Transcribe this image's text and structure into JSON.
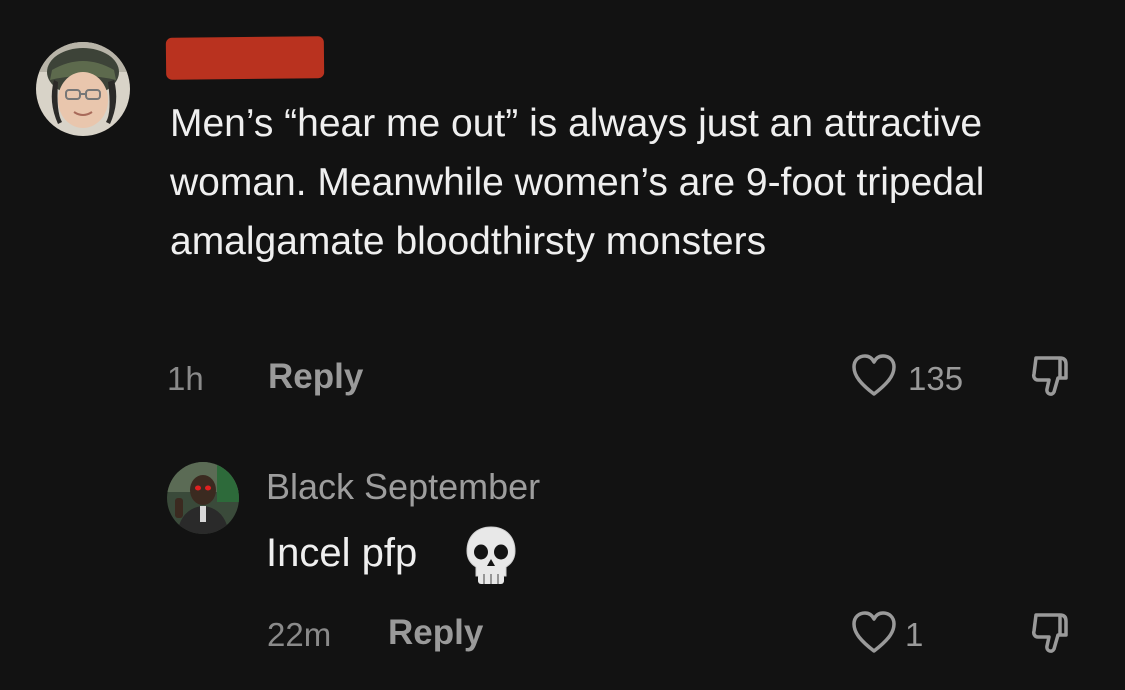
{
  "comment": {
    "text": "Men’s “hear me out” is always just an attractive woman. Meanwhile women’s are 9-foot tripedal amalgamate bloodthirsty monsters",
    "time": "1h",
    "reply_label": "Reply",
    "like_count": "135"
  },
  "reply": {
    "username": "Black September",
    "text": "Incel pfp",
    "emoji": "skull",
    "time": "22m",
    "reply_label": "Reply",
    "like_count": "1"
  },
  "colors": {
    "background": "#121212",
    "redaction": "#b9321f",
    "primary_text": "#efefef",
    "secondary_text": "#9a9a9a"
  }
}
